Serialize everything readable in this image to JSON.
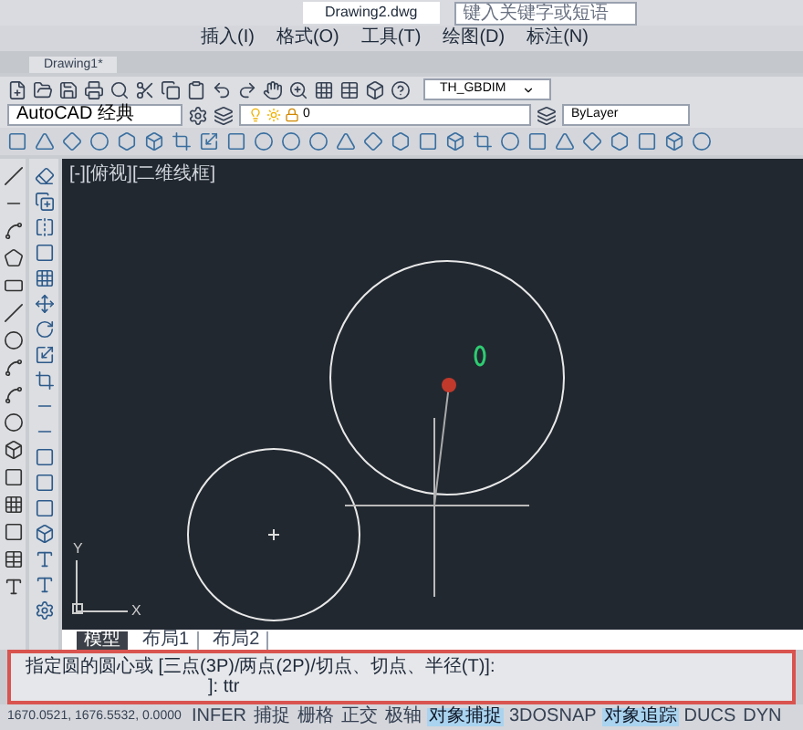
{
  "window": {
    "title": "Drawing2.dwg",
    "search": {
      "placeholder": "键入关键字或短语"
    }
  },
  "menu": [
    "插入(I)",
    "格式(O)",
    "工具(T)",
    "绘图(D)",
    "标注(N)"
  ],
  "file_tabs": [
    {
      "label": "Drawing1*",
      "selected": true
    }
  ],
  "toolbar": {
    "text_style": "TH_GBDIM",
    "workspace": "AutoCAD 经典",
    "layer": "0",
    "linetype": "ByLayer"
  },
  "viewport": {
    "label": "[-][俯视][二维线框]"
  },
  "ucs": {
    "x_label": "X",
    "y_label": "Y"
  },
  "layout_tabs": [
    {
      "label": "模型",
      "selected": true
    },
    {
      "label": "布局1",
      "selected": false
    },
    {
      "label": "布局2",
      "selected": false
    }
  ],
  "command": {
    "lines": [
      "指定圆的圆心或 [三点(3P)/两点(2P)/切点、切点、半径(T)]:",
      "]: ttr"
    ]
  },
  "status_bar": {
    "coordinates": "1670.0521, 1676.5532, 0.0000",
    "toggles": [
      {
        "label": "INFER",
        "on": false
      },
      {
        "label": "捕捉",
        "on": false
      },
      {
        "label": "栅格",
        "on": false
      },
      {
        "label": "正交",
        "on": false
      },
      {
        "label": "极轴",
        "on": false
      },
      {
        "label": "对象捕捉",
        "on": true
      },
      {
        "label": "3DOSNAP",
        "on": false
      },
      {
        "label": "对象追踪",
        "on": true
      },
      {
        "label": "DUCS",
        "on": false
      },
      {
        "label": "DYN",
        "on": false
      }
    ]
  }
}
